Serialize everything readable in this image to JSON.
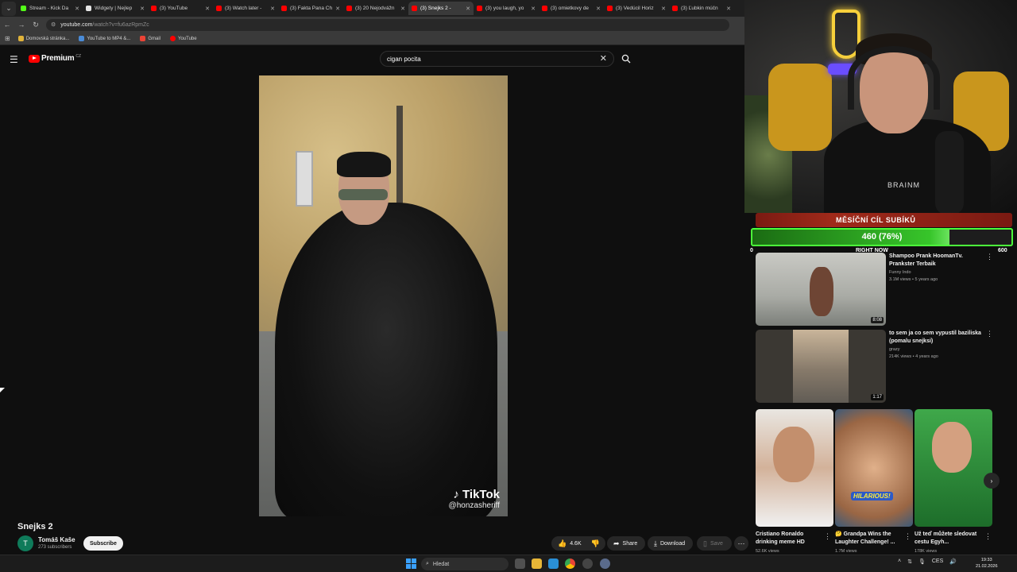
{
  "browser": {
    "tabs": [
      {
        "label": "Stream - Kick Da",
        "color": "#53fc18"
      },
      {
        "label": "Widgety | Nejlep",
        "color": "#e5e5e5"
      },
      {
        "label": "(3) YouTube",
        "color": "#ff0000"
      },
      {
        "label": "(3) Watch later -",
        "color": "#ff0000"
      },
      {
        "label": "(3) Fakta Pana Ch",
        "color": "#ff0000"
      },
      {
        "label": "(3) 20 Nejodvážn",
        "color": "#ff0000"
      },
      {
        "label": "(3) Snejks 2 -",
        "color": "#ff0000",
        "active": true
      },
      {
        "label": "(3) you laugh, yo",
        "color": "#ff0000"
      },
      {
        "label": "(3) omietkovy de",
        "color": "#ff0000"
      },
      {
        "label": "(3) Vedúcil Horiz",
        "color": "#ff0000"
      },
      {
        "label": "(3) Ľubkin múčn",
        "color": "#ff0000"
      }
    ],
    "url_host": "youtube.com",
    "url_path": "/watch?v=fu6azRpmZc",
    "bookmarks": [
      {
        "label": "Domovská stránka...",
        "color": "#e0b33a"
      },
      {
        "label": "YouTube to MP4 &...",
        "color": "#4a8bd6"
      },
      {
        "label": "Gmail",
        "color": "#ea4335"
      },
      {
        "label": "YouTube",
        "color": "#ff0000"
      }
    ]
  },
  "youtube": {
    "brand": "Premium",
    "brand_region": "CZ",
    "search_query": "cigan pocita",
    "video": {
      "title": "Snejks 2",
      "watermark_brand": "TikTok",
      "watermark_handle": "@honzasheriff"
    },
    "channel": {
      "avatar_letter": "T",
      "name": "Tomáš Kaše",
      "subscribers": "273 subscribers",
      "subscribe_label": "Subscribe"
    },
    "actions": {
      "likes": "4.6K",
      "share": "Share",
      "download": "Download",
      "save": "Save"
    },
    "recommendations": [
      {
        "title": "Shampoo Prank HoomanTv. Prankster Terbaik",
        "channel": "Funny Indo",
        "meta": "3.1M views • 5 years ago",
        "duration": "8:08"
      },
      {
        "title": "to sem ja co sem vypustil baziliska (pomalu snejksi)",
        "channel": "grazy",
        "meta": "214K views • 4 years ago",
        "duration": "1:17"
      }
    ],
    "shorts": [
      {
        "title": "Cristiano Ronaldo drinking meme HD",
        "meta": "52.6K views"
      },
      {
        "title": "🤔 Grandpa Wins the Laughter Challenge! ...",
        "meta": "1.7M views",
        "overlay": "HILARIOUS!"
      },
      {
        "title": "Už teď můžete sledovat cestu Egyh...",
        "meta": "178K views"
      }
    ]
  },
  "stream": {
    "cam_brand": "BRAINM",
    "goal_title": "MĚSÍČNÍ CÍL SUBÍKŮ",
    "goal_value": "460 (76%)",
    "goal_progress": 0.76,
    "goal_min": "0",
    "goal_max": "600",
    "goal_sub": "RIGHT NOW"
  },
  "taskbar": {
    "search_placeholder": "Hledat",
    "tray_lang": "CES",
    "time": "19:33",
    "date": "21.02.2026"
  }
}
